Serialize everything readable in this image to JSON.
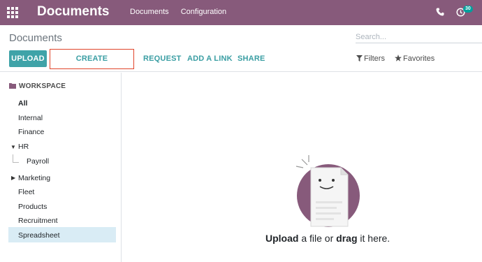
{
  "navbar": {
    "app_title": "Documents",
    "menu": [
      "Documents",
      "Configuration"
    ],
    "activity_count": "30",
    "colors": {
      "bar": "#875a7b",
      "badge": "#00a09d"
    }
  },
  "control_panel": {
    "title": "Documents",
    "search_placeholder": "Search...",
    "buttons": {
      "upload": "UPLOAD",
      "create_spreadsheet": "CREATE SPREADSHEET",
      "request": "REQUEST",
      "add_link": "ADD A LINK",
      "share": "SHARE"
    },
    "filters_label": "Filters",
    "favorites_label": "Favorites"
  },
  "sidebar": {
    "header": "WORKSPACE",
    "folders": {
      "all": "All",
      "internal": "Internal",
      "finance": "Finance",
      "hr": "HR",
      "payroll": "Payroll",
      "marketing": "Marketing",
      "fleet": "Fleet",
      "products": "Products",
      "recruitment": "Recruitment",
      "spreadsheet": "Spreadsheet"
    }
  },
  "empty_state": {
    "upload_word": "Upload",
    "middle_text": " a file or ",
    "drag_word": "drag",
    "end_text": " it here."
  }
}
